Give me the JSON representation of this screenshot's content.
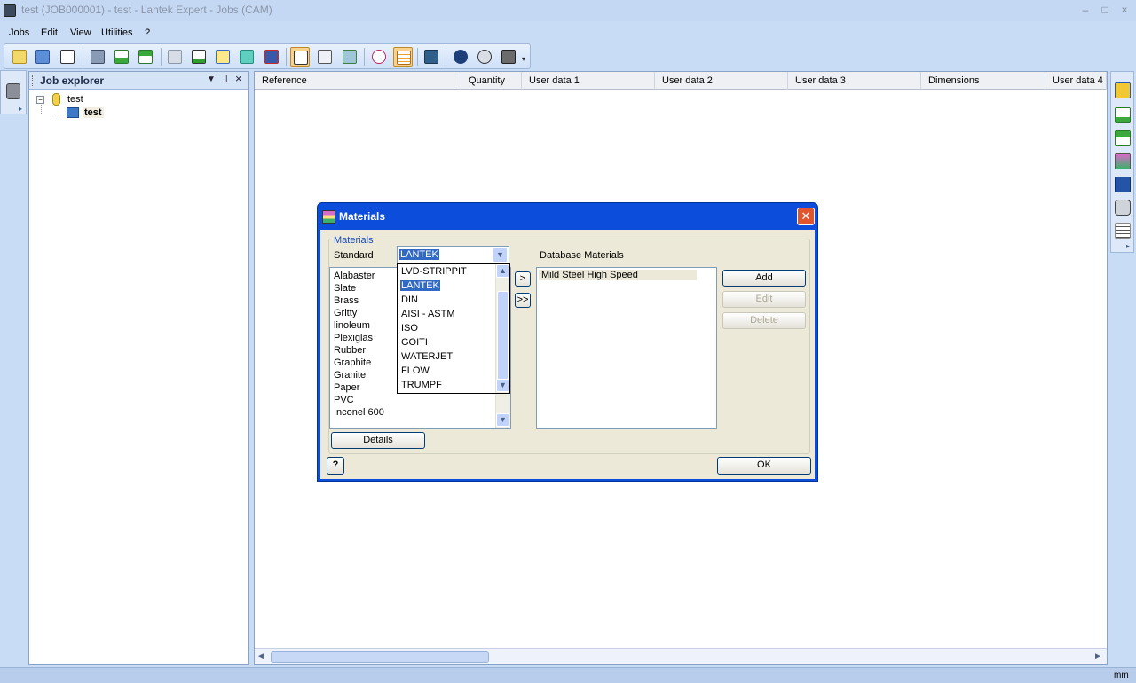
{
  "window": {
    "title": "test (JOB000001) - test - Lantek Expert - Jobs (CAM)",
    "controls": [
      "–",
      "□",
      "×"
    ]
  },
  "menu": [
    "Jobs",
    "Edit",
    "View",
    "Utilities",
    "?"
  ],
  "toolbar": {
    "buttons": [
      "new-icon",
      "open-icon",
      "delete-icon",
      "print-icon",
      "import-icon",
      "export-icon",
      "edit-icon",
      "add-part-icon",
      "measure-icon",
      "nesting-icon",
      "machine-icon",
      "preview-icon",
      "report-icon",
      "assign-icon",
      "search-icon",
      "table-icon",
      "sequence-icon",
      "info-icon",
      "help-icon",
      "tools-icon"
    ],
    "active": [
      "preview-icon",
      "table-icon"
    ]
  },
  "explorer": {
    "title": "Job explorer",
    "root": "test",
    "child": "test"
  },
  "grid": {
    "columns": [
      "Reference",
      "Quantity",
      "User data 1",
      "User data 2",
      "User data 3",
      "Dimensions",
      "User data 4"
    ]
  },
  "status": {
    "units": "mm"
  },
  "dialog": {
    "title": "Materials",
    "group_label": "Materials",
    "standard_label": "Standard",
    "standard_value": "LANTEK",
    "database_label": "Database Materials",
    "dropdown_options": [
      "LVD-STRIPPIT",
      "LANTEK",
      "DIN",
      "AISI - ASTM",
      "ISO",
      "GOITI",
      "WATERJET",
      "FLOW",
      "TRUMPF"
    ],
    "dropdown_selected": "LANTEK",
    "materials": [
      "Alabaster",
      "Slate",
      "Brass",
      "Gritty",
      "linoleum",
      "Plexiglas",
      "Rubber",
      "Graphite",
      "Granite",
      "Paper",
      "PVC",
      "Inconel 600"
    ],
    "database_materials": [
      "Mild Steel High Speed"
    ],
    "buttons": {
      "move_one": ">",
      "move_all": ">>",
      "add": "Add",
      "edit": "Edit",
      "delete": "Delete",
      "details": "Details",
      "ok": "OK",
      "help": "?"
    }
  }
}
